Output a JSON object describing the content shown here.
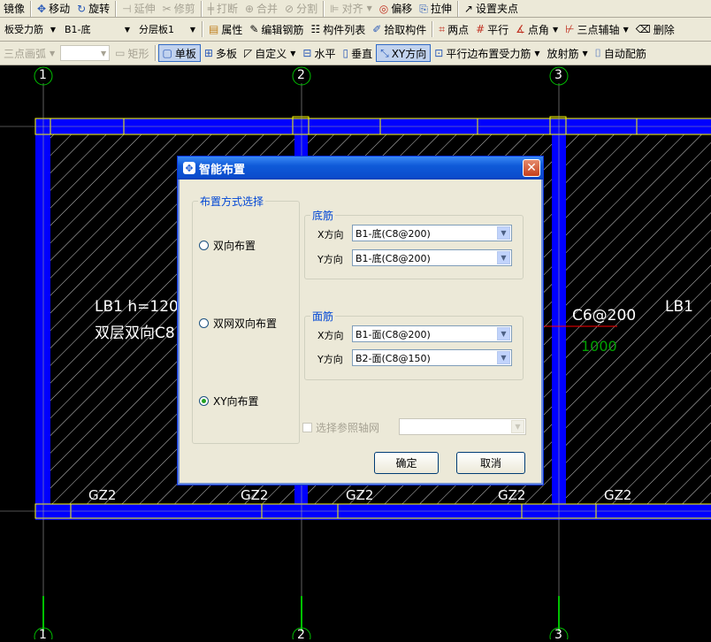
{
  "toolbar1": {
    "items": [
      {
        "label": "镜像",
        "icon": "mirror-icon",
        "disabled": false
      },
      {
        "label": "移动",
        "icon": "move-icon",
        "disabled": false
      },
      {
        "label": "旋转",
        "icon": "rotate-icon",
        "disabled": false
      },
      {
        "label": "延伸",
        "icon": "extend-icon",
        "disabled": true
      },
      {
        "label": "修剪",
        "icon": "trim-icon",
        "disabled": true
      },
      {
        "label": "打断",
        "icon": "break-icon",
        "disabled": true
      },
      {
        "label": "合并",
        "icon": "merge-icon",
        "disabled": true
      },
      {
        "label": "分割",
        "icon": "split-icon",
        "disabled": true
      },
      {
        "label": "对齐",
        "icon": "align-icon",
        "disabled": true
      },
      {
        "label": "偏移",
        "icon": "offset-icon",
        "disabled": false
      },
      {
        "label": "拉伸",
        "icon": "stretch-icon",
        "disabled": false
      },
      {
        "label": "设置夹点",
        "icon": "grip-icon",
        "disabled": false
      }
    ]
  },
  "toolbar2": {
    "combo_type": "板受力筋",
    "combo_rebar": "B1-底",
    "combo_layer": "分层板1",
    "items": [
      {
        "label": "属性",
        "icon": "properties-icon"
      },
      {
        "label": "编辑钢筋",
        "icon": "edit-rebar-icon"
      },
      {
        "label": "构件列表",
        "icon": "component-list-icon"
      },
      {
        "label": "拾取构件",
        "icon": "pick-icon"
      },
      {
        "label": "两点",
        "icon": "two-point-icon"
      },
      {
        "label": "平行",
        "icon": "parallel-icon"
      },
      {
        "label": "点角",
        "icon": "point-angle-icon"
      },
      {
        "label": "三点辅轴",
        "icon": "three-point-axis-icon"
      },
      {
        "label": "删除",
        "icon": "delete-icon"
      }
    ]
  },
  "toolbar3": {
    "arc_label": "三点画弧",
    "rect_label": "矩形",
    "items": [
      {
        "label": "单板",
        "icon": "single-slab-icon",
        "pressed": true
      },
      {
        "label": "多板",
        "icon": "multi-slab-icon",
        "pressed": false
      },
      {
        "label": "自定义",
        "icon": "custom-icon",
        "pressed": false
      },
      {
        "label": "水平",
        "icon": "horizontal-icon",
        "pressed": false
      },
      {
        "label": "垂直",
        "icon": "vertical-icon",
        "pressed": false
      },
      {
        "label": "XY方向",
        "icon": "xy-direction-icon",
        "pressed": true
      },
      {
        "label": "平行边布置受力筋",
        "icon": "parallel-edge-icon",
        "pressed": false
      },
      {
        "label": "放射筋",
        "icon": "radial-icon",
        "pressed": false
      },
      {
        "label": "自动配筋",
        "icon": "auto-rebar-icon",
        "pressed": false
      }
    ]
  },
  "canvas": {
    "axis_labels_top": [
      "1",
      "2",
      "3"
    ],
    "axis_labels_bottom": [
      "1",
      "2",
      "3"
    ],
    "slab_label_line1": "LB1 h=120",
    "slab_label_line2": "双层双向C8",
    "slab_label_right": "LB1",
    "rebar_label": "C6@200",
    "rebar_length": "1000",
    "gz_labels": [
      "GZ2",
      "GZ2",
      "GZ2",
      "GZ2",
      "GZ2"
    ],
    "colors": {
      "beam": "#0000ff",
      "hatch": "#ffffff",
      "yellow": "#ffff00",
      "axis": "#00c000",
      "red": "#ff0000"
    }
  },
  "dialog": {
    "title": "智能布置",
    "layout_group": "布置方式选择",
    "radio_bidirectional": "双向布置",
    "radio_double_mesh": "双网双向布置",
    "radio_xy": "XY向布置",
    "selected": "radio_xy",
    "bottom_group": "底筋",
    "top_group": "面筋",
    "x_label": "X方向",
    "y_label": "Y方向",
    "bottom_x": "B1-底(C8@200)",
    "bottom_y": "B1-底(C8@200)",
    "top_x": "B1-面(C8@200)",
    "top_y": "B2-面(C8@150)",
    "ref_axis_label": "选择参照轴网",
    "ok": "确定",
    "cancel": "取消"
  }
}
